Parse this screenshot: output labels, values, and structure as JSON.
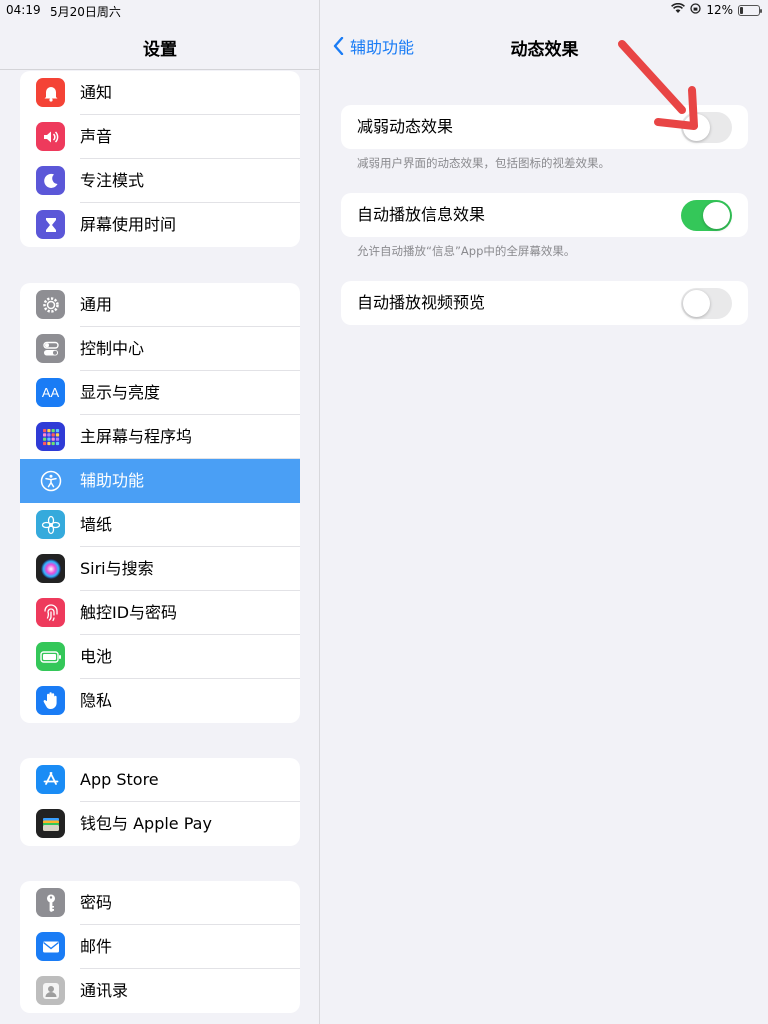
{
  "status": {
    "time": "04:19",
    "date": "5月20日周六",
    "battery": "12%"
  },
  "sidebar": {
    "title": "设置",
    "groups": [
      [
        {
          "label": "通知",
          "icon": "bell-icon",
          "color": "#f44336"
        },
        {
          "label": "声音",
          "icon": "speaker-icon",
          "color": "#ee3a5c"
        },
        {
          "label": "专注模式",
          "icon": "moon-icon",
          "color": "#5b57d8"
        },
        {
          "label": "屏幕使用时间",
          "icon": "hourglass-icon",
          "color": "#5b57d8"
        }
      ],
      [
        {
          "label": "通用",
          "icon": "gear-icon",
          "color": "#8e8e93"
        },
        {
          "label": "控制中心",
          "icon": "switches-icon",
          "color": "#8e8e93"
        },
        {
          "label": "显示与亮度",
          "icon": "text-size-icon",
          "color": "#1a7cf5"
        },
        {
          "label": "主屏幕与程序坞",
          "icon": "grid-icon",
          "color": "#2f3bd6"
        },
        {
          "label": "辅助功能",
          "icon": "accessibility-icon",
          "color": "#1a7cf5",
          "selected": true
        },
        {
          "label": "墙纸",
          "icon": "flower-icon",
          "color": "#35aadc"
        },
        {
          "label": "Siri与搜索",
          "icon": "siri-icon",
          "color": "#222"
        },
        {
          "label": "触控ID与密码",
          "icon": "fingerprint-icon",
          "color": "#ee3a5c"
        },
        {
          "label": "电池",
          "icon": "battery-icon",
          "color": "#34c759"
        },
        {
          "label": "隐私",
          "icon": "hand-icon",
          "color": "#1a7cf5"
        }
      ],
      [
        {
          "label": "App Store",
          "icon": "appstore-icon",
          "color": "#1a8cf5"
        },
        {
          "label": "钱包与 Apple Pay",
          "icon": "wallet-icon",
          "color": "#222"
        }
      ],
      [
        {
          "label": "密码",
          "icon": "key-icon",
          "color": "#8e8e93"
        },
        {
          "label": "邮件",
          "icon": "mail-icon",
          "color": "#1a7cf5"
        },
        {
          "label": "通讯录",
          "icon": "contacts-icon",
          "color": "#bdbdbd"
        }
      ]
    ]
  },
  "detail": {
    "back_label": "辅助功能",
    "title": "动态效果",
    "settings": [
      {
        "label": "减弱动态效果",
        "on": false,
        "footer": "减弱用户界面的动态效果，包括图标的视差效果。"
      },
      {
        "label": "自动播放信息效果",
        "on": true,
        "footer": "允许自动播放“信息”App中的全屏幕效果。"
      },
      {
        "label": "自动播放视频预览",
        "on": false
      }
    ]
  },
  "colors": {
    "accent": "#1a7cf5",
    "toggle_on": "#34c759",
    "selected_row": "#4a9ff5",
    "annotation_arrow": "#e84545"
  }
}
